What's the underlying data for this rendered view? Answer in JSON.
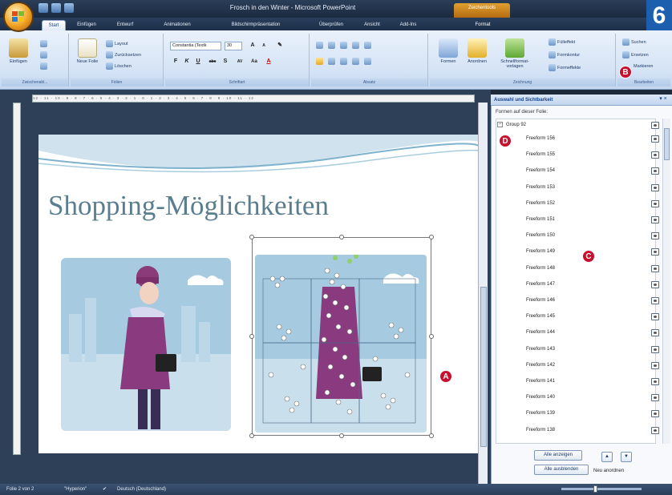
{
  "window": {
    "title": "Frosch in den Winter - Microsoft PowerPoint",
    "contextual_tab_group": "Zeichentools",
    "corner_number": "6"
  },
  "tabs": [
    {
      "label": "Start",
      "active": true
    },
    {
      "label": "Einfügen"
    },
    {
      "label": "Entwurf"
    },
    {
      "label": "Animationen"
    },
    {
      "label": "Bildschirmpräsentation"
    },
    {
      "label": "Überprüfen"
    },
    {
      "label": "Ansicht"
    },
    {
      "label": "Add-Ins"
    },
    {
      "label": "Format"
    }
  ],
  "ribbon": {
    "clipboard": {
      "label": "Zwischenabl...",
      "paste": "Einfügen"
    },
    "slides": {
      "label": "Folien",
      "new_slide": "Neue Folie",
      "layout": "Layout",
      "reset": "Zurücksetzen",
      "delete": "Löschen"
    },
    "font": {
      "label": "Schriftart",
      "font_name": "Constantia (Textk",
      "font_size": "30",
      "grow": "A",
      "shrink": "A",
      "bold": "F",
      "italic": "K",
      "underline": "U",
      "strike": "abc",
      "shadow": "S",
      "spacing": "AV",
      "case": "Aa",
      "color": "A"
    },
    "paragraph": {
      "label": "Absatz"
    },
    "drawing": {
      "label": "Zeichnung",
      "shapes": "Formen",
      "arrange": "Anordnen",
      "quick_styles": "Schnellformat-vorlagen",
      "fill": "Fülleffekt",
      "outline": "Formkontur",
      "effects": "Formeffekte"
    },
    "editing": {
      "label": "Bearbeiten",
      "find": "Suchen",
      "replace": "Ersetzen",
      "select": "Markieren"
    }
  },
  "slide": {
    "title": "Shopping-Möglichkeiten"
  },
  "pane": {
    "title": "Auswahl und Sichtbarkeit",
    "subtitle": "Formen auf dieser Folie:",
    "group_name": "Group 92",
    "items": [
      "Freeform 156",
      "Freeform 155",
      "Freeform 154",
      "Freeform 153",
      "Freeform 152",
      "Freeform 151",
      "Freeform 150",
      "Freeform 149",
      "Freeform 148",
      "Freeform 147",
      "Freeform 146",
      "Freeform 145",
      "Freeform 144",
      "Freeform 143",
      "Freeform 142",
      "Freeform 141",
      "Freeform 140",
      "Freeform 139",
      "Freeform 138"
    ],
    "show_all": "Alle anzeigen",
    "hide_all": "Alle ausblenden",
    "reorder_label": "Neu anordnen",
    "up_arrow": "▲",
    "down_arrow": "▼"
  },
  "callouts": {
    "a": "A",
    "b": "B",
    "c": "C",
    "d": "D"
  },
  "status": {
    "slide_count": "Folie 2 von 2",
    "theme": "\"Hyperion\"",
    "language": "Deutsch (Deutschland)"
  },
  "colors": {
    "accent": "#c8102e",
    "slide_bg_pic": "#a6cbe0",
    "title_text": "#5b7e8e"
  }
}
